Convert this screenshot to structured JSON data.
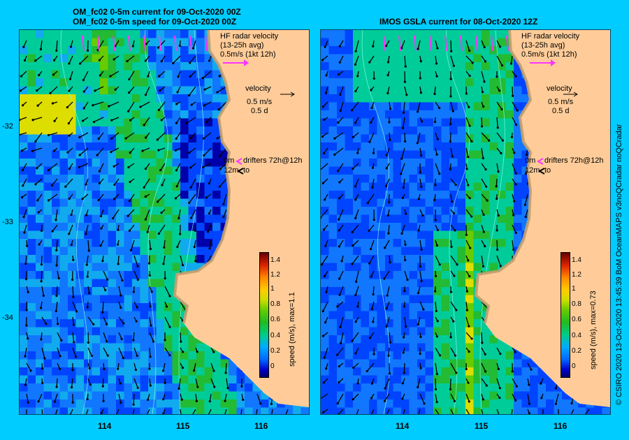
{
  "left_panel": {
    "title_line1": "OM_fc02 0-5m current for 09-Oct-2020 00Z",
    "title_line2": "OM_fc02 0-5m speed for 09-Oct-2020 00Z",
    "colorbar_label": "speed (m/s), max=1.1"
  },
  "right_panel": {
    "title_line1": "IMOS GSLA current for 08-Oct-2020 12Z",
    "colorbar_label": "speed (m/s), max=0.73"
  },
  "legend": {
    "hf_radar_line1": "HF radar velocity",
    "hf_radar_line2": "(13-25h avg)",
    "hf_radar_line3": "0.5m/s (1kt 12h)",
    "velocity_line1": "velocity",
    "velocity_line2": "0.5 m/s",
    "velocity_line3": "0.5 d",
    "drifters_line1_depth": "0m",
    "drifters_line1_text": "drifters 72h@12h",
    "drifters_line2_depth": "12m",
    "drifters_line2_text": "to"
  },
  "y_ticks": [
    "-32",
    "-33",
    "-34"
  ],
  "x_ticks": [
    "114",
    "115",
    "116"
  ],
  "colorbar_ticks": [
    "1.4",
    "1.2",
    "1",
    "0.8",
    "0.6",
    "0.4",
    "0.2",
    "0"
  ],
  "credit": "© CSIRO 2020   13-Oct-2020 13:45:39 BoM OceanMAPS v3noQCradar noQCradar",
  "colors": {
    "background": "#00ccff",
    "land": "#ffcc99",
    "radar_arrow": "#ff33ff",
    "current_arrow": "#000000",
    "drifter_arrow": "#ffffff"
  }
}
